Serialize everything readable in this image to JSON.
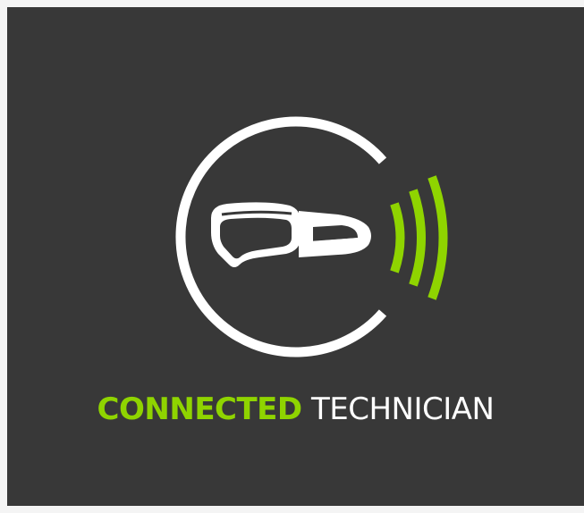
{
  "brand": {
    "word_primary": "CONNECTED",
    "word_secondary": "TECHNICIAN"
  },
  "colors": {
    "background": "#383838",
    "accent": "#8fd400",
    "foreground": "#ffffff",
    "page": "#f4f4f4"
  },
  "icons": {
    "ring": "c-ring-icon",
    "headset": "ar-headset-icon",
    "signal": "signal-waves-icon"
  }
}
